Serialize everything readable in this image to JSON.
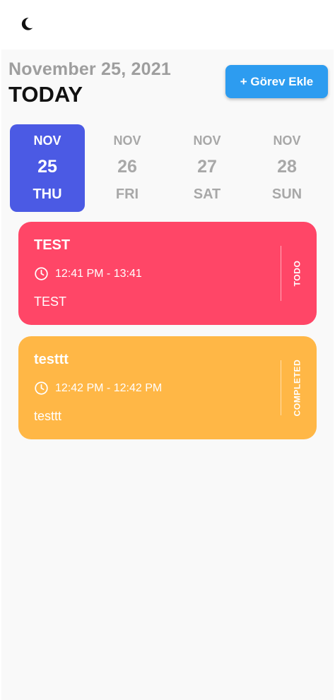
{
  "header": {
    "date": "November 25, 2021",
    "title": "TODAY",
    "add_task_label": "+ Görev Ekle"
  },
  "icons": {
    "theme_toggle": "crescent-moon-icon",
    "clock": "clock-icon"
  },
  "days": [
    {
      "month": "NOV",
      "day": "25",
      "weekday": "THU",
      "selected": true
    },
    {
      "month": "NOV",
      "day": "26",
      "weekday": "FRI",
      "selected": false
    },
    {
      "month": "NOV",
      "day": "27",
      "weekday": "SAT",
      "selected": false
    },
    {
      "month": "NOV",
      "day": "28",
      "weekday": "SUN",
      "selected": false
    }
  ],
  "tasks": [
    {
      "title": "TEST",
      "time": "12:41 PM - 13:41",
      "note": "TEST",
      "status": "TODO",
      "color": "#ff4667"
    },
    {
      "title": "testtt",
      "time": "12:42 PM - 12:42 PM",
      "note": "testtt",
      "status": "COMPLETED",
      "color": "#ffb746"
    }
  ],
  "colors": {
    "accent": "#4b5ae4",
    "button": "#2d9cf0"
  }
}
